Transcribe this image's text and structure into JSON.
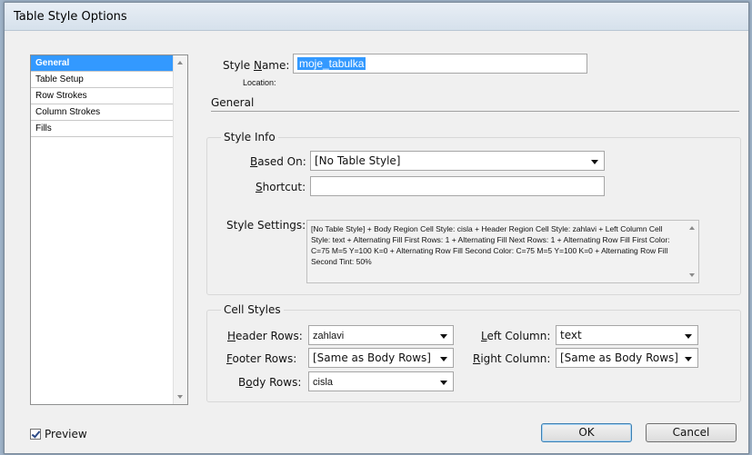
{
  "window": {
    "title": "Table Style Options"
  },
  "sidebar": {
    "items": [
      {
        "label": "General",
        "selected": true
      },
      {
        "label": "Table Setup",
        "selected": false
      },
      {
        "label": "Row Strokes",
        "selected": false
      },
      {
        "label": "Column Strokes",
        "selected": false
      },
      {
        "label": "Fills",
        "selected": false
      }
    ]
  },
  "header": {
    "style_name_label": "Style Name:",
    "style_name_value": "moje_tabulka",
    "location_label": "Location:",
    "section_label": "General"
  },
  "style_info": {
    "title": "Style Info",
    "based_on_label": "Based On:",
    "based_on_value": "[No Table Style]",
    "shortcut_label": "Shortcut:",
    "shortcut_value": "",
    "settings_label": "Style Settings:",
    "settings_text": "[No Table Style] + Body Region Cell Style: cisla + Header Region Cell Style: zahlavi + Left Column Cell Style: text + Alternating Fill First Rows: 1 + Alternating Fill Next Rows: 1 + Alternating Row Fill First Color: C=75 M=5 Y=100 K=0 + Alternating Row Fill Second Color: C=75 M=5 Y=100 K=0 + Alternating Row Fill Second Tint: 50%"
  },
  "cell_styles": {
    "title": "Cell Styles",
    "header_rows_label": "Header Rows:",
    "header_rows_value": "zahlavi",
    "footer_rows_label": "Footer Rows:",
    "footer_rows_value": "[Same as Body Rows]",
    "body_rows_label": "Body Rows:",
    "body_rows_value": "cisla",
    "left_column_label": "Left Column:",
    "left_column_value": "text",
    "right_column_label": "Right Column:",
    "right_column_value": "[Same as Body Rows]"
  },
  "footer": {
    "preview_label": "Preview",
    "preview_checked": true,
    "ok_label": "OK",
    "cancel_label": "Cancel"
  }
}
